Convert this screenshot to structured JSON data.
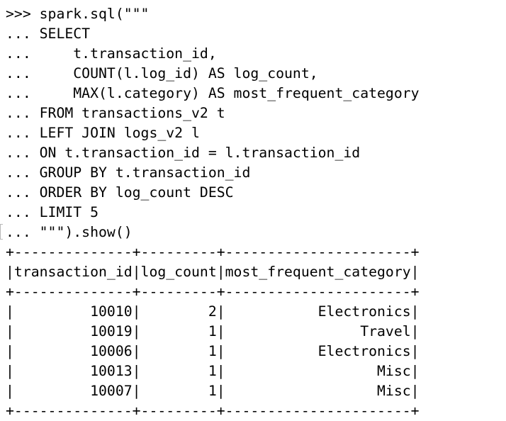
{
  "terminal": {
    "lines": [
      ">>> spark.sql(\"\"\"",
      "... SELECT",
      "...     t.transaction_id,",
      "...     COUNT(l.log_id) AS log_count,",
      "...     MAX(l.category) AS most_frequent_category",
      "... FROM transactions_v2 t",
      "... LEFT JOIN logs_v2 l",
      "... ON t.transaction_id = l.transaction_id",
      "... GROUP BY t.transaction_id",
      "... ORDER BY log_count DESC",
      "... LIMIT 5",
      "... \"\"\").show()",
      "+--------------+---------+----------------------+",
      "|transaction_id|log_count|most_frequent_category|",
      "+--------------+---------+----------------------+",
      "|         10010|        2|           Electronics|",
      "|         10019|        1|                Travel|",
      "|         10006|        1|           Electronics|",
      "|         10013|        1|                  Misc|",
      "|         10007|        1|                  Misc|",
      "+--------------+---------+----------------------+"
    ]
  }
}
